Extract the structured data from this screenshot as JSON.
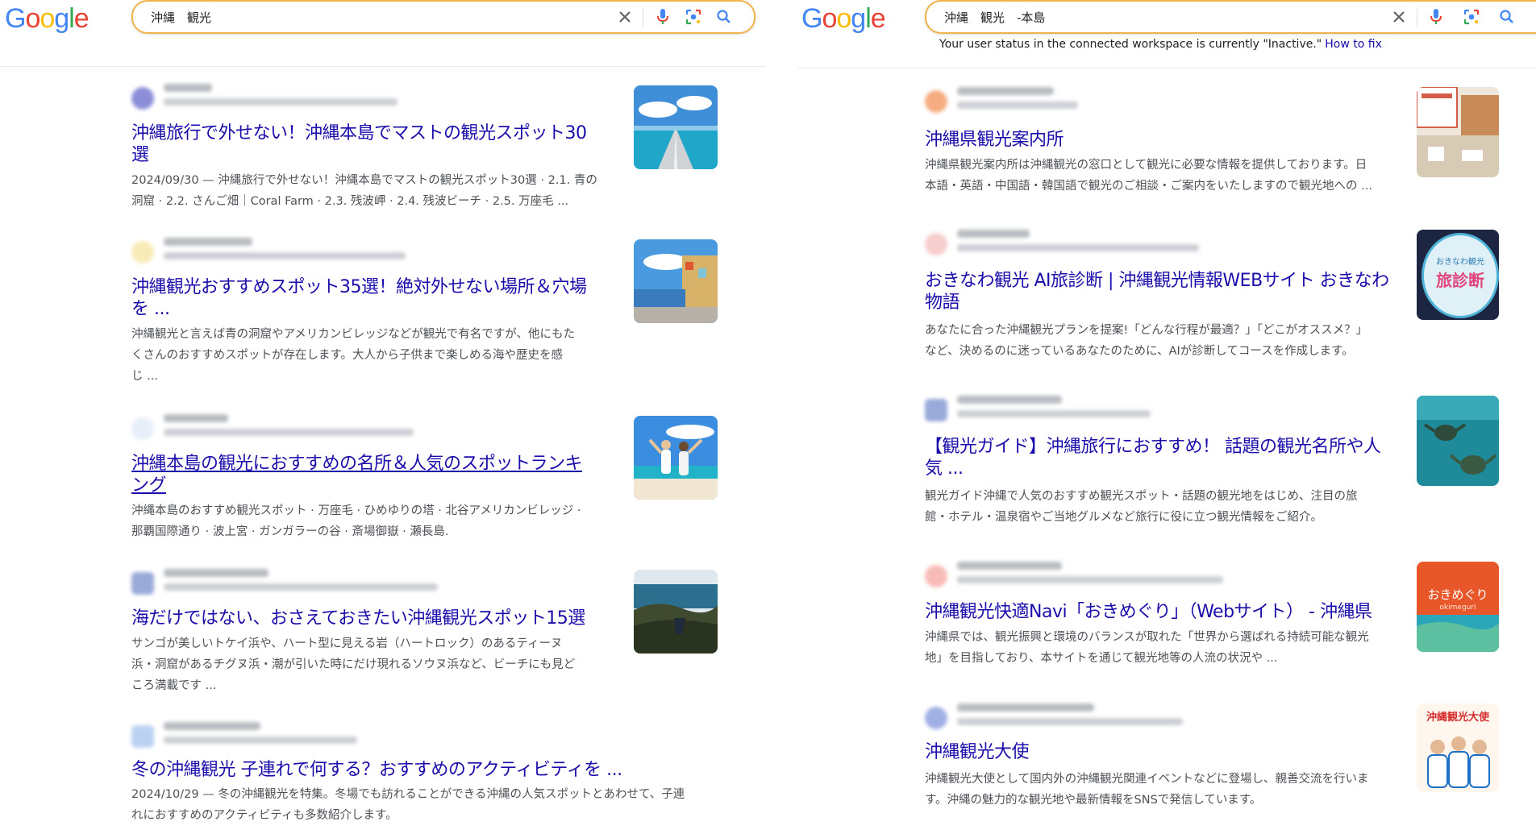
{
  "colors": {
    "link": "#1a0dab",
    "snippet": "#4d5156",
    "search_border": "#f2b24a"
  },
  "left": {
    "logo": "Google",
    "query": "沖縄　観光",
    "icons": [
      "close-icon",
      "mic-icon",
      "lens-icon",
      "search-icon"
    ],
    "results": [
      {
        "title_line1": "沖縄旅行で外せない！沖縄本島でマストの観光スポット30",
        "title_line2": "選",
        "snippet_line1": "2024/09/30 — 沖縄旅行で外せない！沖縄本島でマストの観光スポット30選 · 2.1. 青の",
        "snippet_line2": "洞窟 · 2.2. さんご畑｜Coral Farm · 2.3. 残波岬 · 2.4. 残波ビーチ · 2.5. 万座毛 ...",
        "snippet_line3": ""
      },
      {
        "title_line1": "沖縄観光おすすめスポット35選！絶対外せない場所＆穴場",
        "title_line2": "を ...",
        "snippet_line1": "沖縄観光と言えば青の洞窟やアメリカンビレッジなどが観光で有名ですが、他にもた",
        "snippet_line2": "くさんのおすすめスポットが存在します。大人から子供まで楽しめる海や歴史を感",
        "snippet_line3": "じ ..."
      },
      {
        "title_line1": "沖縄本島の観光におすすめの名所＆人気のスポットランキ",
        "title_line2": "ング",
        "snippet_line1": "沖縄本島のおすすめ観光スポット · 万座毛 · ひめゆりの塔 · 北谷アメリカンビレッジ ·",
        "snippet_line2": "那覇国際通り · 波上宮 · ガンガラーの谷 · 斎場御嶽 · 瀬長島.",
        "snippet_line3": ""
      },
      {
        "title_line1": "海だけではない、おさえておきたい沖縄観光スポット15選",
        "title_line2": "",
        "snippet_line1": "サンゴが美しいトケイ浜や、ハート型に見える岩（ハートロック）のあるティーヌ",
        "snippet_line2": "浜・洞窟があるチグヌ浜・潮が引いた時にだけ現れるソウヌ浜など、ビーチにも見ど",
        "snippet_line3": "ころ満載です ..."
      },
      {
        "title_line1": "冬の沖縄観光 子連れで何する？おすすめのアクティビティを ...",
        "title_line2": "",
        "snippet_line1": "2024/10/29 — 冬の沖縄観光を特集。冬場でも訪れることができる沖縄の人気スポットとあわせて、子連",
        "snippet_line2": "れにおすすめのアクティビティも多数紹介します。",
        "snippet_line3": ""
      }
    ]
  },
  "right": {
    "logo": "Google",
    "query": "沖縄　観光　-本島",
    "icons": [
      "close-icon",
      "mic-icon",
      "lens-icon",
      "search-icon"
    ],
    "status_text": "Your user status in the connected workspace is currently \"Inactive.\"",
    "status_link": "How to fix",
    "results": [
      {
        "title_line1": "沖縄県観光案内所",
        "title_line2": "",
        "snippet_line1": "沖縄県観光案内所は沖縄観光の窓口として観光に必要な情報を提供しております。日",
        "snippet_line2": "本語・英語・中国語・韓国語で観光のご相談・ご案内をいたしますので観光地への ..."
      },
      {
        "title_line1": "おきなわ観光 AI旅診断 | 沖縄観光情報WEBサイト おきなわ",
        "title_line2": "物語",
        "snippet_line1": "あなたに合った沖縄観光プランを提案!「どんな行程が最適？」「どこがオススメ？」",
        "snippet_line2": "など、決めるのに迷っているあなたのために、AIが診断してコースを作成します。"
      },
      {
        "title_line1": "【観光ガイド】沖縄旅行におすすめ！ 話題の観光名所や人",
        "title_line2": "気 ...",
        "snippet_line1": "観光ガイド沖縄で人気のおすすめ観光スポット・話題の観光地をはじめ、注目の旅",
        "snippet_line2": "館・ホテル・温泉宿やご当地グルメなど旅行に役に立つ観光情報をご紹介。"
      },
      {
        "title_line1": "沖縄観光快適Navi「おきめぐり」（Webサイト） - 沖縄県",
        "title_line2": "",
        "snippet_line1": "沖縄県では、観光振興と環境のバランスが取れた「世界から選ばれる持続可能な観光",
        "snippet_line2": "地」を目指しており、本サイトを通じて観光地等の人流の状況や ..."
      },
      {
        "title_line1": "沖縄観光大使",
        "title_line2": "",
        "snippet_line1": "沖縄観光大使として国内外の沖縄観光関連イベントなどに登場し、親善交流を行いま",
        "snippet_line2": "す。沖縄の魅力的な観光地や最新情報をSNSで発信しています。"
      }
    ],
    "thumb_text": {
      "t2_line1": "おきなわ観光",
      "t2_line2": "旅診断",
      "t4": "おきめぐり",
      "t4_sub": "okimeguri",
      "t5": "沖縄観光大使"
    }
  }
}
